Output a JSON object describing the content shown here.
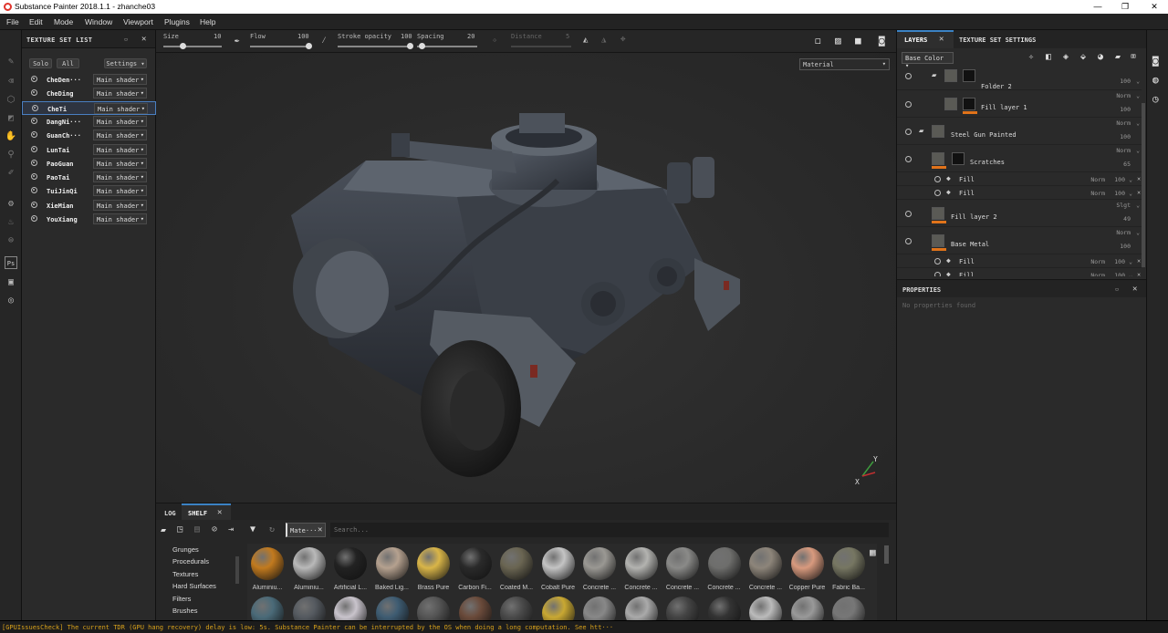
{
  "window": {
    "title": "Substance Painter 2018.1.1 - zhanche03",
    "min": "—",
    "max": "❐",
    "close": "✕"
  },
  "menu": [
    "File",
    "Edit",
    "Mode",
    "Window",
    "Viewport",
    "Plugins",
    "Help"
  ],
  "texture_set_list": {
    "title": "TEXTURE SET LIST",
    "solo": "Solo",
    "all": "All",
    "settings": "Settings",
    "items": [
      {
        "name": "CheDen···",
        "shader": "Main shader"
      },
      {
        "name": "CheDing",
        "shader": "Main shader"
      },
      {
        "name": "CheTi",
        "shader": "Main shader"
      },
      {
        "name": "DangNi···",
        "shader": "Main shader"
      },
      {
        "name": "GuanCh···",
        "shader": "Main shader"
      },
      {
        "name": "LunTai",
        "shader": "Main shader"
      },
      {
        "name": "PaoGuan",
        "shader": "Main shader"
      },
      {
        "name": "PaoTai",
        "shader": "Main shader"
      },
      {
        "name": "TuiJinQi",
        "shader": "Main shader"
      },
      {
        "name": "XieMian",
        "shader": "Main shader"
      },
      {
        "name": "YouXiang",
        "shader": "Main shader"
      }
    ],
    "selected_index": 2
  },
  "toolbar": {
    "size_label": "Size",
    "size_value": "10",
    "flow_label": "Flow",
    "flow_value": "100",
    "stroke_label": "Stroke opacity",
    "stroke_value": "100",
    "spacing_label": "Spacing",
    "spacing_value": "20",
    "distance_label": "Distance",
    "distance_value": "5"
  },
  "viewport": {
    "material_mode": "Material",
    "axis_y": "Y",
    "axis_x": "X"
  },
  "shelf": {
    "tabs": [
      "LOG",
      "SHELF"
    ],
    "filter_tag": "Mate···",
    "search_placeholder": "Search...",
    "categories": [
      "Grunges",
      "Procedurals",
      "Textures",
      "Hard Surfaces",
      "Filters",
      "Brushes"
    ],
    "materials": [
      {
        "name": "Aluminiu...",
        "color": "#c27a1e"
      },
      {
        "name": "Aluminiu...",
        "color": "#b9b9b9"
      },
      {
        "name": "Artificial L...",
        "color": "#222222"
      },
      {
        "name": "Baked Lig...",
        "color": "#b5a18f"
      },
      {
        "name": "Brass Pure",
        "color": "#d9b548"
      },
      {
        "name": "Carbon Fi...",
        "color": "#2a2a2a"
      },
      {
        "name": "Coated M...",
        "color": "#6a6552"
      },
      {
        "name": "Cobalt Pure",
        "color": "#c4c4c4"
      },
      {
        "name": "Concrete ...",
        "color": "#9a9893"
      },
      {
        "name": "Concrete ...",
        "color": "#b3b3b0"
      },
      {
        "name": "Concrete ...",
        "color": "#8a8a88"
      },
      {
        "name": "Concrete ...",
        "color": "#6e6e6c"
      },
      {
        "name": "Concrete ...",
        "color": "#8d857a"
      },
      {
        "name": "Copper Pure",
        "color": "#d89a7e"
      },
      {
        "name": "Fabric Ba...",
        "color": "#767662"
      }
    ],
    "row2_colors": [
      "#4a6a78",
      "#555a60",
      "#c9c4cc",
      "#3e5c72",
      "#555555",
      "#6a4a3a",
      "#4a4a4a",
      "#c9a832",
      "#888888",
      "#aaaaaa",
      "#444444",
      "#333333",
      "#bbbbbb",
      "#999999",
      "#777777"
    ]
  },
  "layers": {
    "tab_layers": "LAYERS",
    "tab_settings": "TEXTURE SET SETTINGS",
    "channel": "Base Color",
    "rows": [
      {
        "name": "Folder 2",
        "blend": "100"
      },
      {
        "name": "Fill layer 1",
        "mode": "Norm",
        "blend": "100"
      },
      {
        "name": "Steel Gun Painted",
        "mode": "Norm",
        "blend": "100"
      },
      {
        "name": "Scratches",
        "mode": "Norm",
        "blend": "65"
      },
      {
        "name": "Fill",
        "mode": "Norm",
        "blend": "100"
      },
      {
        "name": "Fill",
        "mode": "Norm",
        "blend": "100"
      },
      {
        "name": "Fill layer 2",
        "mode": "Slgt",
        "blend": "49"
      },
      {
        "name": "Base Metal",
        "mode": "Norm",
        "blend": "100"
      },
      {
        "name": "Fill",
        "mode": "Norm",
        "blend": "100"
      },
      {
        "name": "Fill",
        "mode": "Norm",
        "blend": "100"
      }
    ]
  },
  "properties": {
    "title": "PROPERTIES",
    "empty": "No properties found"
  },
  "status": "[GPUIssuesCheck] The current TDR (GPU hang recovery) delay is low: 5s. Substance Painter can be interrupted by the OS when doing a long computation. See htt···"
}
